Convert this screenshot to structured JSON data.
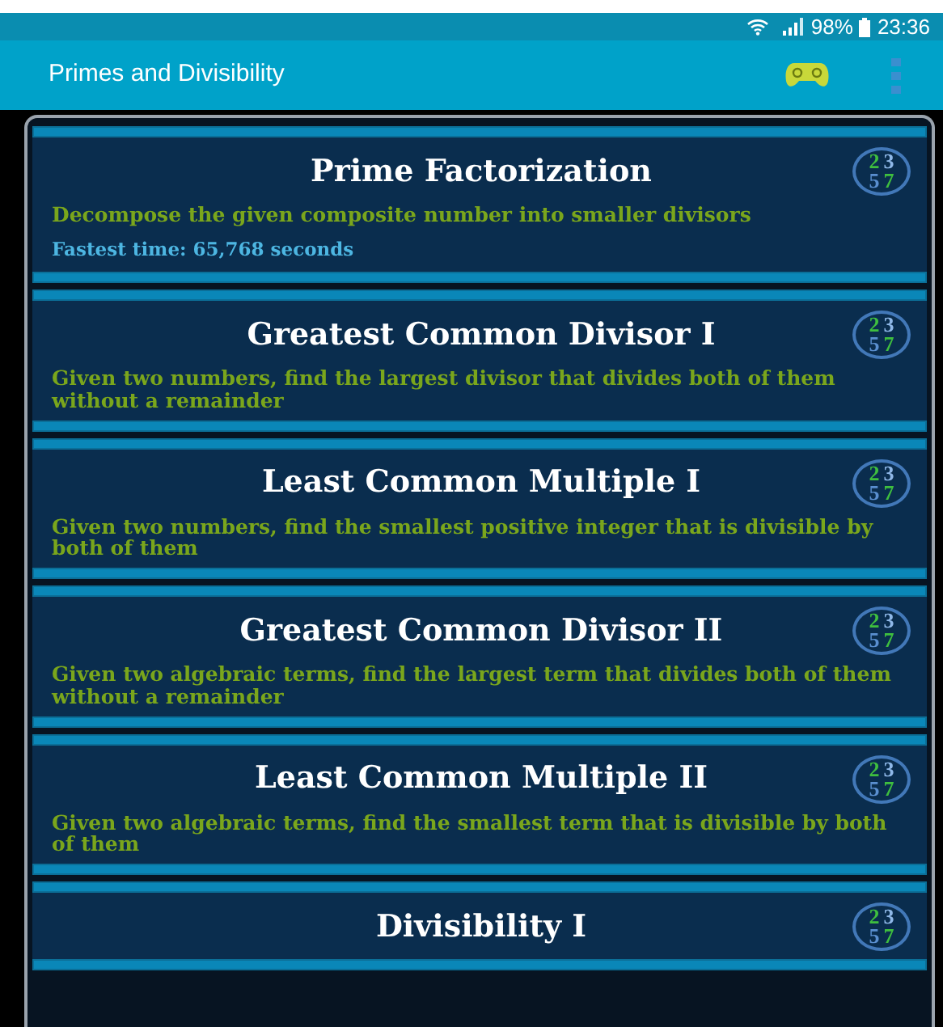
{
  "status_bar": {
    "battery": "98%",
    "time": "23:36"
  },
  "app_bar": {
    "title": "Primes and Divisibility"
  },
  "tasks": [
    {
      "title": "Prime Factorization",
      "description": "Decompose the given composite number into smaller divisors",
      "fastest_time": "Fastest time: 65,768 seconds",
      "badge": [
        {
          "text": "2",
          "color": "#3fbf3f"
        },
        {
          "text": "3",
          "color": "#8fb8e8"
        },
        {
          "text": "5",
          "color": "#5a8fd0"
        },
        {
          "text": "7",
          "color": "#3fbf3f"
        }
      ]
    },
    {
      "title": "Greatest Common Divisor I",
      "description": "Given two numbers, find the largest divisor that divides both of them without a remainder",
      "badge": [
        {
          "text": "2",
          "color": "#3fbf3f"
        },
        {
          "text": "3",
          "color": "#8fb8e8"
        },
        {
          "text": "5",
          "color": "#5a8fd0"
        },
        {
          "text": "7",
          "color": "#3fbf3f"
        }
      ]
    },
    {
      "title": "Least Common Multiple I",
      "description": "Given two numbers, find the smallest positive integer that is divisible by both of them",
      "badge": [
        {
          "text": "2",
          "color": "#3fbf3f"
        },
        {
          "text": "3",
          "color": "#8fb8e8"
        },
        {
          "text": "5",
          "color": "#5a8fd0"
        },
        {
          "text": "7",
          "color": "#3fbf3f"
        }
      ]
    },
    {
      "title": "Greatest Common Divisor II",
      "description": "Given two algebraic terms, find the largest term that divides both of them without a remainder",
      "badge": [
        {
          "text": "2",
          "color": "#3fbf3f"
        },
        {
          "text": "3",
          "color": "#8fb8e8"
        },
        {
          "text": "5",
          "color": "#5a8fd0"
        },
        {
          "text": "7",
          "color": "#3fbf3f"
        }
      ]
    },
    {
      "title": "Least Common Multiple II",
      "description": "Given two algebraic terms, find the smallest term that is divisible by both of them",
      "badge": [
        {
          "text": "2",
          "color": "#3fbf3f"
        },
        {
          "text": "3",
          "color": "#8fb8e8"
        },
        {
          "text": "5",
          "color": "#5a8fd0"
        },
        {
          "text": "7",
          "color": "#3fbf3f"
        }
      ]
    },
    {
      "title": "Divisibility I",
      "badge": [
        {
          "text": "2",
          "color": "#3fbf3f"
        },
        {
          "text": "3",
          "color": "#8fb8e8"
        },
        {
          "text": "5",
          "color": "#5a8fd0"
        },
        {
          "text": "7",
          "color": "#3fbf3f"
        }
      ]
    }
  ]
}
